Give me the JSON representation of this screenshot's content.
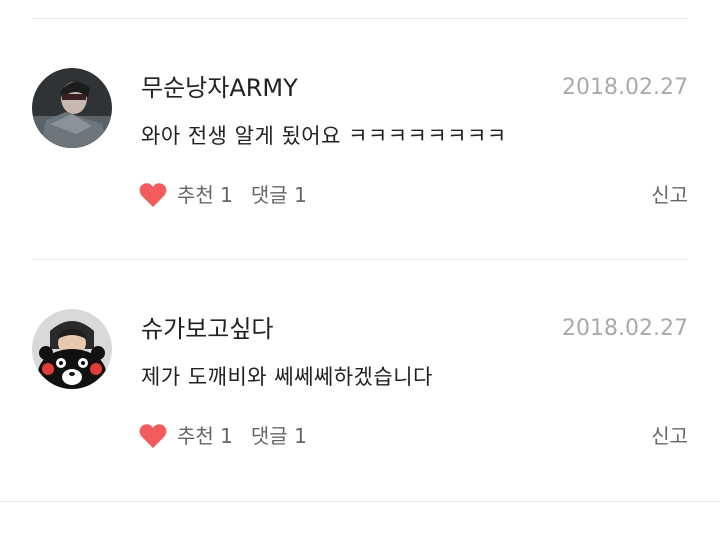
{
  "comments": [
    {
      "username": "무순낭자ARMY",
      "date": "2018.02.27",
      "text": "와아 전생 알게 됬어요 ㅋㅋㅋㅋㅋㅋㅋㅋ",
      "like_label": "추천",
      "like_count": "1",
      "reply_label": "댓글",
      "reply_count": "1",
      "report_label": "신고",
      "avatar_icon": "user-avatar-photo"
    },
    {
      "username": "슈가보고싶다",
      "date": "2018.02.27",
      "text": "제가 도깨비와 쎄쎄쎄하겠습니다",
      "like_label": "추천",
      "like_count": "1",
      "reply_label": "댓글",
      "reply_count": "1",
      "report_label": "신고",
      "avatar_icon": "kumamon-avatar"
    }
  ],
  "colors": {
    "heart": "#f25c5c",
    "text": "#222222",
    "muted": "#aaaaaa",
    "divider": "#e6e6e6"
  }
}
